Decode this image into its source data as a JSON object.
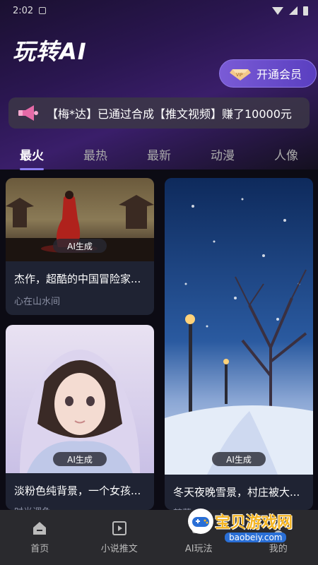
{
  "status": {
    "time": "2:02"
  },
  "app_title": "玩转AI",
  "vip_button": {
    "label": "开通会员",
    "icon": "vip-diamond-icon"
  },
  "notice": {
    "text": "【梅*达】已通过合成【推文视频】赚了10000元",
    "icon": "megaphone-icon"
  },
  "tabs": [
    {
      "label": "最火",
      "active": true
    },
    {
      "label": "最热"
    },
    {
      "label": "最新"
    },
    {
      "label": "动漫"
    },
    {
      "label": "人像"
    }
  ],
  "cards": [
    {
      "badge": "AI生成",
      "title": "杰作，超酷的中国冒险家...",
      "author": "心在山水间"
    },
    {
      "badge": "AI生成",
      "title": "淡粉色纯背景，一个女孩...",
      "author": "时光调色"
    },
    {
      "badge": "AI生成",
      "title": "冬天夜晚雪景，村庄被大...",
      "author": "梦落"
    }
  ],
  "bottom_nav": [
    {
      "label": "首页",
      "icon": "home-icon"
    },
    {
      "label": "小说推文",
      "icon": "video-icon"
    },
    {
      "label": "AI玩法",
      "icon": "ai-icon"
    },
    {
      "label": "我的",
      "icon": "profile-icon"
    }
  ],
  "watermark": {
    "text": "宝贝游戏网",
    "url": "baobeiy.com"
  },
  "colors": {
    "accent": "#8b7cf0",
    "vip": "#6a4fd0",
    "card_bg": "#1f2333",
    "nav_bg": "#2a2a2e"
  }
}
